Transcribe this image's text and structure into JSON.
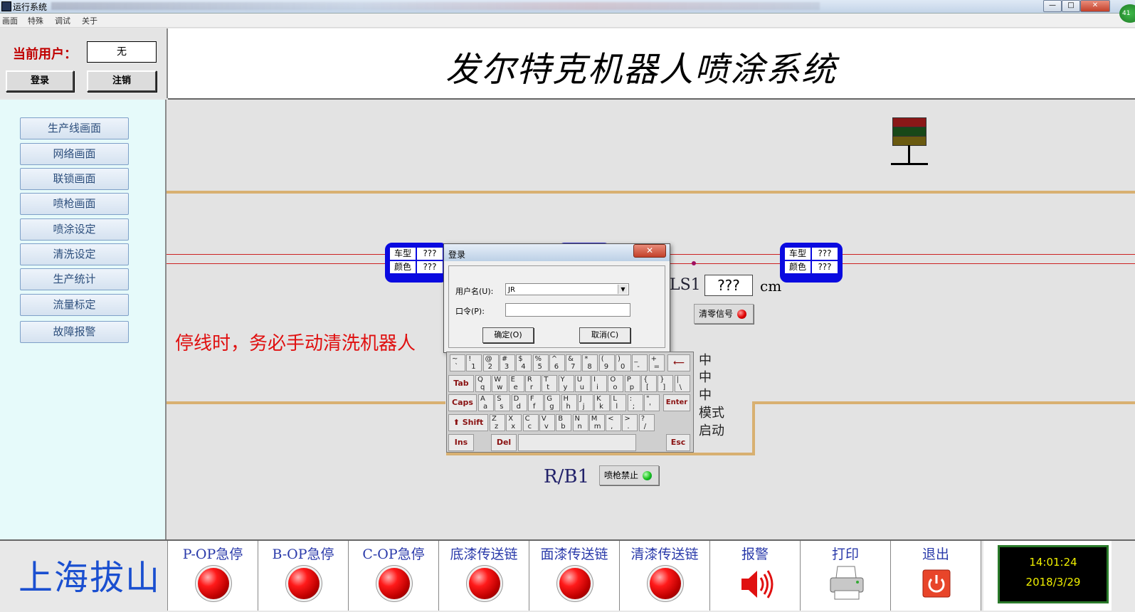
{
  "window": {
    "title": "运行系统",
    "buttons": {
      "minimize": "—",
      "maximize": "□",
      "close": "✕"
    },
    "badge": "41"
  },
  "menu": {
    "items": [
      "画面",
      "特殊",
      "调试",
      "关于"
    ]
  },
  "user": {
    "label": "当前用户：",
    "value": "无",
    "login": "登录",
    "logout": "注销"
  },
  "header": {
    "title": "发尔特克机器人喷涂系统"
  },
  "sidebar": {
    "items": [
      "生产线画面",
      "网络画面",
      "联锁画面",
      "喷枪画面",
      "喷涂设定",
      "清洗设定",
      "生产统计",
      "流量标定",
      "故障报警"
    ]
  },
  "canvas": {
    "left_box": {
      "car_label": "车型",
      "car_value": "???",
      "color_label": "颜色",
      "color_value": "???"
    },
    "right_box": {
      "car_label": "车型",
      "car_value": "???",
      "color_label": "颜色",
      "color_value": "???"
    },
    "ls1": {
      "label": "LS1",
      "value": "???",
      "unit": "cm"
    },
    "clear_signal": "清零信号",
    "warning": "停线时，务必手动清洗机器人",
    "status_lines": [
      "中",
      "中",
      "中",
      "模式",
      "启动"
    ],
    "rb1": "R/B1",
    "gun_disable": "喷枪禁止"
  },
  "dialog": {
    "title": "登录",
    "close": "✕",
    "username_label": "用户名(U):",
    "username_value": "JR",
    "password_label": "口令(P):",
    "ok": "确定(O)",
    "cancel": "取消(C)"
  },
  "keyboard": {
    "rows": [
      [
        [
          "~",
          "`"
        ],
        [
          "!",
          "1"
        ],
        [
          "@",
          "2"
        ],
        [
          "#",
          "3"
        ],
        [
          "$",
          "4"
        ],
        [
          "%",
          "5"
        ],
        [
          "^",
          "6"
        ],
        [
          "&",
          "7"
        ],
        [
          "*",
          "8"
        ],
        [
          "(",
          "9"
        ],
        [
          ")",
          "0"
        ],
        [
          "_",
          "-"
        ],
        [
          "+",
          "="
        ]
      ],
      [
        [
          "Q",
          "q"
        ],
        [
          "W",
          "w"
        ],
        [
          "E",
          "e"
        ],
        [
          "R",
          "r"
        ],
        [
          "T",
          "t"
        ],
        [
          "Y",
          "y"
        ],
        [
          "U",
          "u"
        ],
        [
          "I",
          "i"
        ],
        [
          "O",
          "o"
        ],
        [
          "P",
          "p"
        ],
        [
          "{",
          "["
        ],
        [
          "}",
          "]"
        ],
        [
          "|",
          "\\"
        ]
      ],
      [
        [
          "A",
          "a"
        ],
        [
          "S",
          "s"
        ],
        [
          "D",
          "d"
        ],
        [
          "F",
          "f"
        ],
        [
          "G",
          "g"
        ],
        [
          "H",
          "h"
        ],
        [
          "J",
          "j"
        ],
        [
          "K",
          "k"
        ],
        [
          "L",
          "l"
        ],
        [
          ":",
          ";"
        ],
        [
          "\"",
          "'"
        ]
      ],
      [
        [
          "Z",
          "z"
        ],
        [
          "X",
          "x"
        ],
        [
          "C",
          "c"
        ],
        [
          "V",
          "v"
        ],
        [
          "B",
          "b"
        ],
        [
          "N",
          "n"
        ],
        [
          "M",
          "m"
        ],
        [
          "<",
          ","
        ],
        [
          ">",
          "."
        ],
        [
          "?",
          "/"
        ]
      ]
    ],
    "backspace": "⟵",
    "tab": "Tab",
    "caps": "Caps",
    "enter": "Enter",
    "shift": "⬆ Shift",
    "ins": "Ins",
    "del": "Del",
    "esc": "Esc"
  },
  "bottom": {
    "brand": "上海拔山",
    "cells": [
      "P-OP急停",
      "B-OP急停",
      "C-OP急停",
      "底漆传送链",
      "面漆传送链",
      "清漆传送链",
      "报警",
      "打印",
      "退出"
    ],
    "clock": {
      "time": "14:01:24",
      "date": "2018/3/29"
    }
  },
  "colors": {
    "accent_red": "#e00000",
    "led_green": "#18c018",
    "brand_blue": "#1a4fd0",
    "conveyor_tan": "#d8b071",
    "clock_text": "#f0f000"
  }
}
